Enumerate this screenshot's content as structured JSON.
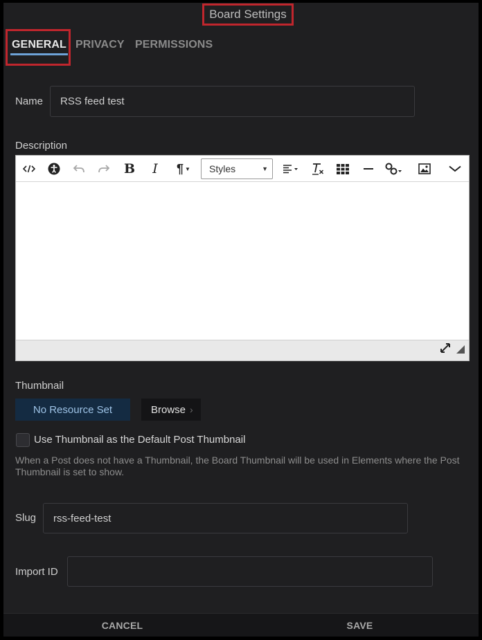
{
  "dialog": {
    "title": "Board Settings"
  },
  "tabs": [
    {
      "label": "GENERAL",
      "active": true
    },
    {
      "label": "PRIVACY",
      "active": false
    },
    {
      "label": "PERMISSIONS",
      "active": false
    }
  ],
  "form": {
    "name": {
      "label": "Name",
      "value": "RSS feed test"
    },
    "description": {
      "label": "Description",
      "styles_select": "Styles",
      "toolbar_icons": [
        "source-code-icon",
        "accessibility-icon",
        "undo-icon",
        "redo-icon",
        "bold-icon",
        "italic-icon",
        "paragraph-icon",
        "align-icon",
        "clear-format-icon",
        "table-icon",
        "horizontal-rule-icon",
        "link-icon",
        "image-icon",
        "more-icon"
      ],
      "toolbar_glyphs": {
        "bold": "B",
        "italic": "I",
        "paragraph": "¶"
      }
    },
    "thumbnail": {
      "label": "Thumbnail",
      "resource_value": "No Resource Set",
      "browse_label": "Browse",
      "checkbox_label": "Use Thumbnail as the Default Post Thumbnail",
      "checkbox_checked": false,
      "help_text": "When a Post does not have a Thumbnail, the Board Thumbnail will be used in Elements where the Post Thumbnail is set to show."
    },
    "slug": {
      "label": "Slug",
      "value": "rss-feed-test"
    },
    "import_id": {
      "label": "Import ID",
      "value": ""
    }
  },
  "footer": {
    "cancel_label": "CANCEL",
    "save_label": "SAVE"
  },
  "colors": {
    "panel_bg": "#1f1f21",
    "highlight_border": "#c0262d",
    "active_tab_underline": "#6ea3d8",
    "resource_bg": "#142b42"
  }
}
